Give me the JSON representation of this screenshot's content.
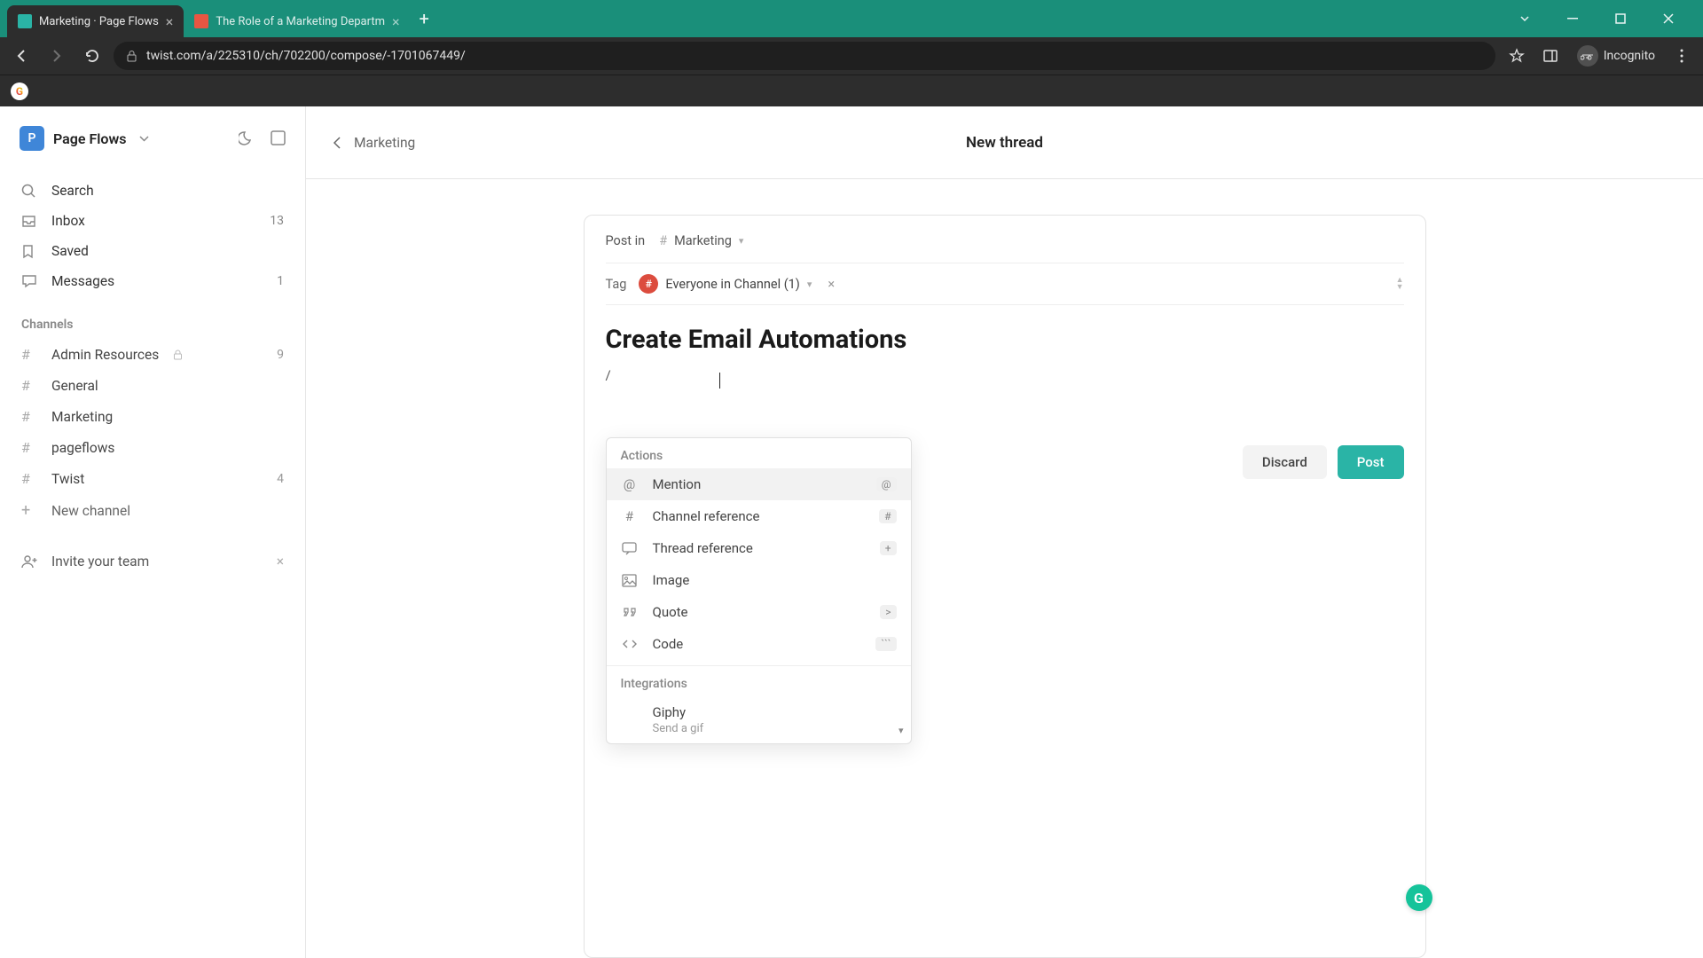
{
  "browser": {
    "tabs": [
      {
        "title": "Marketing · Page Flows",
        "active": true
      },
      {
        "title": "The Role of a Marketing Departm",
        "active": false
      }
    ],
    "url": "twist.com/a/225310/ch/702200/compose/-1701067449/",
    "incognito_label": "Incognito"
  },
  "sidebar": {
    "workspace": {
      "initial": "P",
      "name": "Page Flows"
    },
    "nav": {
      "search": "Search",
      "inbox": {
        "label": "Inbox",
        "count": "13"
      },
      "saved": "Saved",
      "messages": {
        "label": "Messages",
        "count": "1"
      }
    },
    "channels_label": "Channels",
    "channels": [
      {
        "name": "Admin Resources",
        "locked": true,
        "count": "9"
      },
      {
        "name": "General"
      },
      {
        "name": "Marketing"
      },
      {
        "name": "pageflows"
      },
      {
        "name": "Twist",
        "count": "4"
      }
    ],
    "new_channel": "New channel",
    "invite": "Invite your team"
  },
  "header": {
    "back_label": "Marketing",
    "title": "New thread"
  },
  "compose": {
    "post_in_label": "Post in",
    "channel": "Marketing",
    "tag_label": "Tag",
    "tag_text": "Everyone in Channel (1)",
    "tag_initial": "#",
    "title": "Create Email Automations",
    "body": "/",
    "discard": "Discard",
    "post": "Post"
  },
  "slash_menu": {
    "actions_label": "Actions",
    "actions": [
      {
        "label": "Mention",
        "shortcut": "@",
        "icon": "@"
      },
      {
        "label": "Channel reference",
        "shortcut": "#",
        "icon": "#"
      },
      {
        "label": "Thread reference",
        "shortcut": "+",
        "icon": "thread"
      },
      {
        "label": "Image",
        "shortcut": "",
        "icon": "image"
      },
      {
        "label": "Quote",
        "shortcut": ">",
        "icon": "quote"
      },
      {
        "label": "Code",
        "shortcut": "```",
        "icon": "code"
      }
    ],
    "integrations_label": "Integrations",
    "integrations": [
      {
        "label": "Giphy",
        "sub": "Send a gif"
      }
    ]
  },
  "grammarly": "G"
}
